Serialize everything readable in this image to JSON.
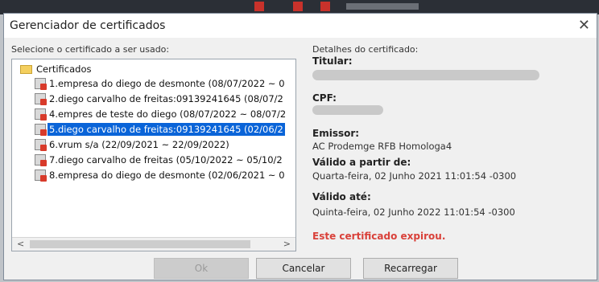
{
  "window": {
    "title": "Gerenciador de certificados",
    "close_glyph": "✕"
  },
  "left_panel": {
    "label": "Selecione o certificado a ser usado:",
    "root": "Certificados",
    "items": [
      {
        "label": "1.empresa do diego de desmonte (08/07/2022 ~ 0"
      },
      {
        "label": "2.diego carvalho de freitas:09139241645 (08/07/2"
      },
      {
        "label": "4.empres de teste do diego (08/07/2022 ~ 08/07/2"
      },
      {
        "label": "5.diego carvalho de freitas:09139241645 (02/06/2",
        "selected": true
      },
      {
        "label": "6.vrum s/a (22/09/2021 ~ 22/09/2022)"
      },
      {
        "label": "7.diego carvalho de freitas (05/10/2022 ~ 05/10/2"
      },
      {
        "label": "8.empresa do diego de desmonte (02/06/2021 ~ 0"
      }
    ],
    "scroll_left": "<",
    "scroll_right": ">"
  },
  "details": {
    "label": "Detalhes do certificado:",
    "titular_label": "Titular:",
    "cpf_label": "CPF:",
    "emissor_label": "Emissor:",
    "emissor_value": "AC Prodemge RFB Homologa4",
    "valido_de_label": "Válido a partir de:",
    "valido_de_value": "Quarta-feira, 02 Junho 2021 11:01:54 -0300",
    "valido_ate_label": "Válido até:",
    "valido_ate_value": "Quinta-feira, 02 Junho 2022 11:01:54 -0300",
    "status": "Este certificado expirou."
  },
  "buttons": {
    "ok": "Ok",
    "cancel": "Cancelar",
    "reload": "Recarregar"
  },
  "colors": {
    "selection": "#0a64d8",
    "expired": "#d9413a"
  }
}
